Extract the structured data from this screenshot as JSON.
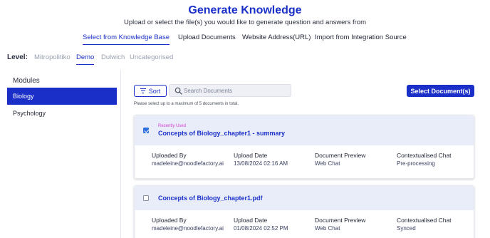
{
  "header": {
    "title": "Generate Knowledge",
    "subtitle": "Upload or select the file(s) you would like to generate question and answers from"
  },
  "tabs": [
    {
      "label": "Select from Knowledge Base",
      "active": true
    },
    {
      "label": "Upload Documents",
      "active": false
    },
    {
      "label": "Website Address(URL)",
      "active": false
    },
    {
      "label": "Import from Integration Source",
      "active": false
    }
  ],
  "levels": {
    "label": "Level:",
    "items": [
      {
        "label": "Mitropolitiko",
        "active": false
      },
      {
        "label": "Demo",
        "active": true
      },
      {
        "label": "Dulwich",
        "active": false
      },
      {
        "label": "Uncategorised",
        "active": false
      }
    ]
  },
  "sidebar": {
    "heading": "Modules",
    "items": [
      {
        "label": "Biology",
        "active": true
      },
      {
        "label": "Psychology",
        "active": false
      }
    ]
  },
  "toolbar": {
    "sort_label": "Sort",
    "search_placeholder": "Search Documents",
    "search_value": "",
    "select_label": "Select Document(s)"
  },
  "hint": "Please select up to a maximum of 5 documents in total.",
  "columns": {
    "uploaded_by": "Uploaded By",
    "upload_date": "Upload Date",
    "document_preview": "Document Preview",
    "contextualised_chat": "Contextualised Chat"
  },
  "documents": [
    {
      "recent_label": "Recently Used",
      "name": "Concepts of Biology_chapter1 - summary",
      "checked": true,
      "uploaded_by": "madeleine@noodlefactory.ai",
      "upload_date": "13/08/2024 02:16 AM",
      "document_preview": "Web Chat",
      "contextualised_chat": "Pre-processing"
    },
    {
      "recent_label": "",
      "name": "Concepts of Biology_chapter1.pdf",
      "checked": false,
      "uploaded_by": "madeleine@noodlefactory.ai",
      "upload_date": "01/08/2024 02:52 PM",
      "document_preview": "Web Chat",
      "contextualised_chat": "Synced"
    }
  ],
  "colors": {
    "accent": "#1a2fc7",
    "recent": "#d43fd1",
    "card_header": "#e9edfa"
  }
}
